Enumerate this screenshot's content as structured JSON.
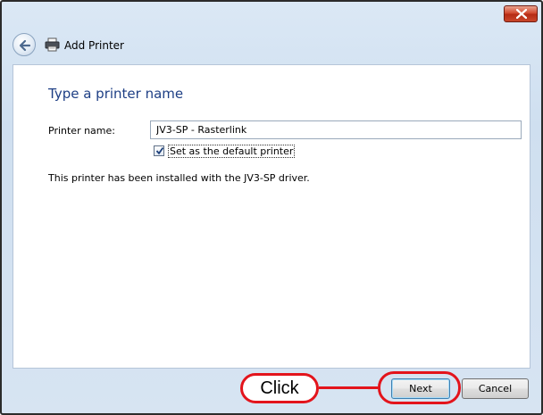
{
  "window": {
    "title": "Add Printer"
  },
  "icons": {
    "close": "close-icon",
    "back": "back-arrow-icon",
    "printer": "printer-icon",
    "check": "checkmark-icon"
  },
  "page": {
    "heading": "Type a printer name",
    "name_label": "Printer name:",
    "name_value": "JV3-SP - Rasterlink",
    "default_checkbox_label": "Set as the default printer",
    "default_checked": true,
    "info": "This printer has been installed with the JV3-SP driver."
  },
  "buttons": {
    "next": "Next",
    "cancel": "Cancel"
  },
  "annotation": {
    "callout_text": "Click",
    "color": "#e3141c"
  }
}
